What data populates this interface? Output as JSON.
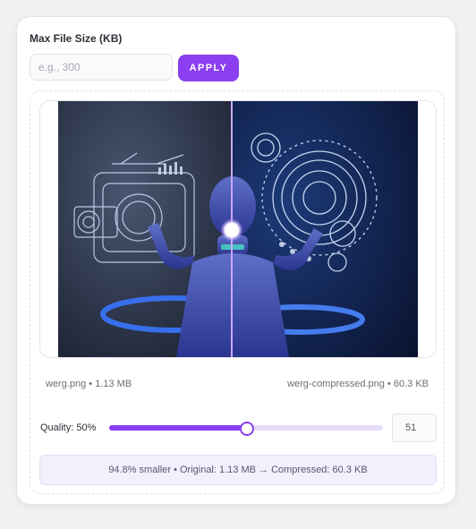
{
  "size_limit": {
    "label": "Max File Size (KB)",
    "placeholder": "e.g., 300",
    "value": "",
    "apply_label": "APPLY"
  },
  "preview": {
    "image_description": "Side-by-side comparison of original and compressed images of a blue robot with holographic interfaces",
    "divider_position": 0.48
  },
  "files": {
    "original": "werg.png • 1.13 MB",
    "compressed": "werg-compressed.png • 60.3 KB"
  },
  "quality": {
    "label": "Quality: 50%",
    "slider_value": 0.5,
    "input_value": "51"
  },
  "summary": "94.8% smaller • Original: 1.13 MB → Compressed: 60.3 KB",
  "colors": {
    "accent": "#8b3ff0",
    "summary_bg": "#f3effc"
  }
}
